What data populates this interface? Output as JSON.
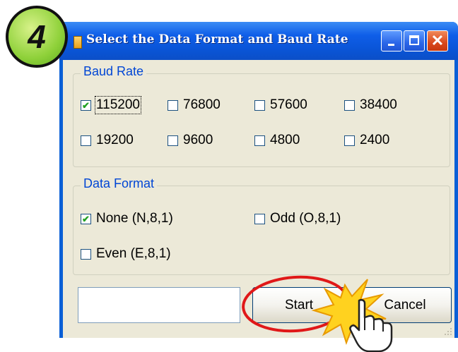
{
  "step_badge": "4",
  "window": {
    "title": "Select the Data Format and Baud Rate"
  },
  "baud_rate": {
    "legend": "Baud Rate",
    "options": [
      {
        "label": "115200",
        "checked": true
      },
      {
        "label": "76800",
        "checked": false
      },
      {
        "label": "57600",
        "checked": false
      },
      {
        "label": "38400",
        "checked": false
      },
      {
        "label": "19200",
        "checked": false
      },
      {
        "label": "9600",
        "checked": false
      },
      {
        "label": "4800",
        "checked": false
      },
      {
        "label": "2400",
        "checked": false
      }
    ]
  },
  "data_format": {
    "legend": "Data Format",
    "options": [
      {
        "label": "None (N,8,1)",
        "checked": true
      },
      {
        "label": "Odd (O,8,1)",
        "checked": false
      },
      {
        "label": "Even (E,8,1)",
        "checked": false
      }
    ]
  },
  "footer": {
    "input_value": "",
    "start_label": "Start",
    "cancel_label": "Cancel"
  },
  "colors": {
    "titlebar": "#0a55d8",
    "client": "#ece9d8",
    "legend_text": "#0046d5",
    "highlight_ring": "#e01818",
    "starburst": "#ffd21f"
  }
}
